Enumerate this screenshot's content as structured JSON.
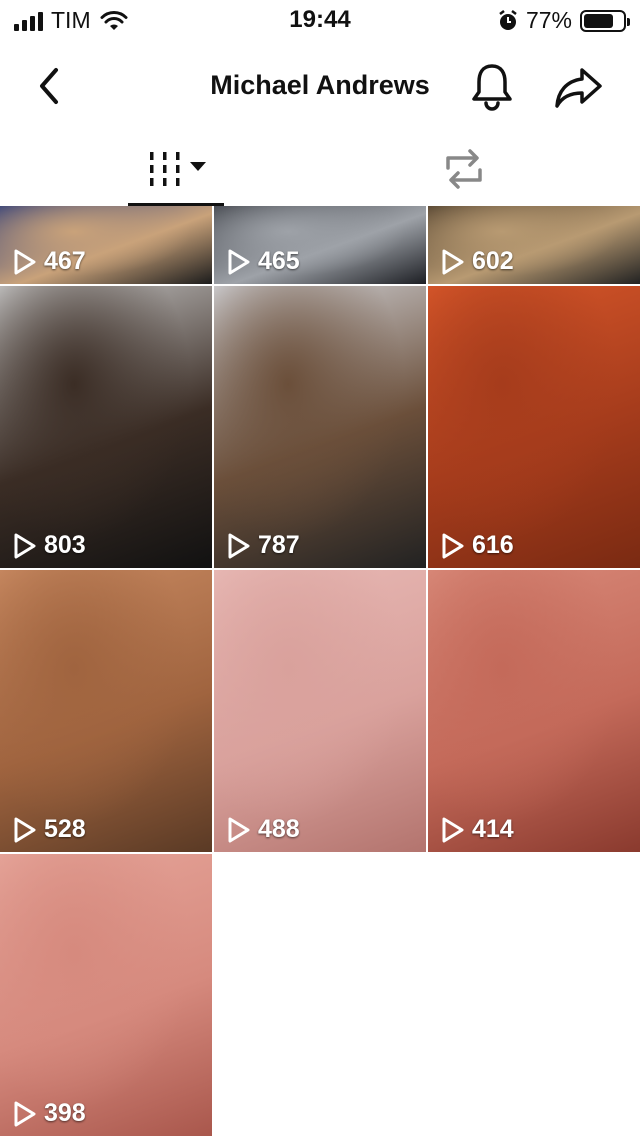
{
  "status": {
    "carrier": "TIM",
    "time": "19:44",
    "battery": "77%",
    "battery_level": 0.77
  },
  "nav": {
    "title": "Michael Andrews",
    "back_icon": "chevron-left-icon",
    "bell_icon": "bell-icon",
    "share_icon": "share-arrow-icon"
  },
  "tabs": {
    "grid_icon": "grid-columns-icon",
    "repost_icon": "repost-icon"
  },
  "videos": [
    {
      "views": "467",
      "colors": [
        "#2a3b7a",
        "#c9a27a",
        "#1c1c1c"
      ]
    },
    {
      "views": "465",
      "colors": [
        "#3a3d44",
        "#9ea2a8",
        "#1d1f24"
      ]
    },
    {
      "views": "602",
      "colors": [
        "#4a3b2a",
        "#b89a72",
        "#222"
      ]
    },
    {
      "views": "803",
      "colors": [
        "#c9c9c9",
        "#3b2d25",
        "#111"
      ]
    },
    {
      "views": "787",
      "colors": [
        "#d4d6db",
        "#6b4f3a",
        "#222"
      ]
    },
    {
      "views": "616",
      "colors": [
        "#d8572a",
        "#a63c1c",
        "#7a2a12"
      ]
    },
    {
      "views": "528",
      "colors": [
        "#c98a62",
        "#a0643f",
        "#5a3a25"
      ]
    },
    {
      "views": "488",
      "colors": [
        "#e8b9b5",
        "#d9a19c",
        "#b3746e"
      ]
    },
    {
      "views": "414",
      "colors": [
        "#d98a7a",
        "#c46a5a",
        "#8a3a2e"
      ]
    },
    {
      "views": "398",
      "colors": [
        "#e6a59a",
        "#d68a7e",
        "#a9574c"
      ]
    }
  ]
}
